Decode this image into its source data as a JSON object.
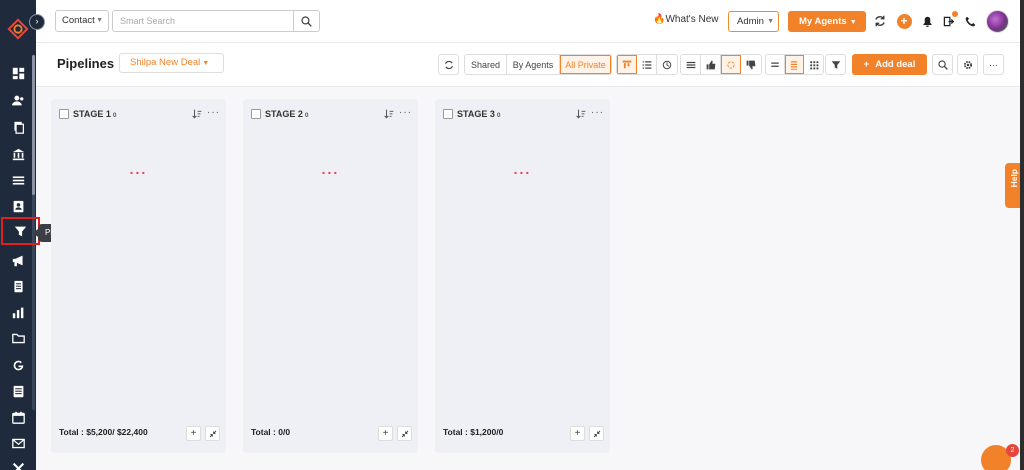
{
  "header": {
    "contact_select": "Contact",
    "search_placeholder": "Smart Search",
    "whats_new": "What's New",
    "admin_select": "Admin",
    "agents_button": "My Agents"
  },
  "sidebar": {
    "tooltip": "Pipelines",
    "items": [
      "dashboard",
      "contacts",
      "documents",
      "bank",
      "list",
      "contacts-book",
      "pipelines",
      "campaigns",
      "notes",
      "reports",
      "folder",
      "google",
      "calendar-grid",
      "calendar",
      "mail",
      "tools"
    ]
  },
  "toolbar": {
    "title": "Pipelines",
    "deal_select": "Shilpa New Deal",
    "shared": "Shared",
    "by_agents": "By Agents",
    "all_private": "All Private",
    "add_deal": "Add deal"
  },
  "stages": [
    {
      "name": "STAGE 1",
      "count": "0",
      "loading": "...",
      "total": "Total : $5,200/ $22,400"
    },
    {
      "name": "STAGE 2",
      "count": "0",
      "loading": "...",
      "total": "Total : 0/0"
    },
    {
      "name": "STAGE 3",
      "count": "0",
      "loading": "...",
      "total": "Total : $1,200/0"
    }
  ],
  "help": "Help",
  "chat_badge": "2",
  "colors": {
    "accent": "#f2822a",
    "sidebar": "#1f2a3c",
    "highlight": "#e0201f"
  }
}
